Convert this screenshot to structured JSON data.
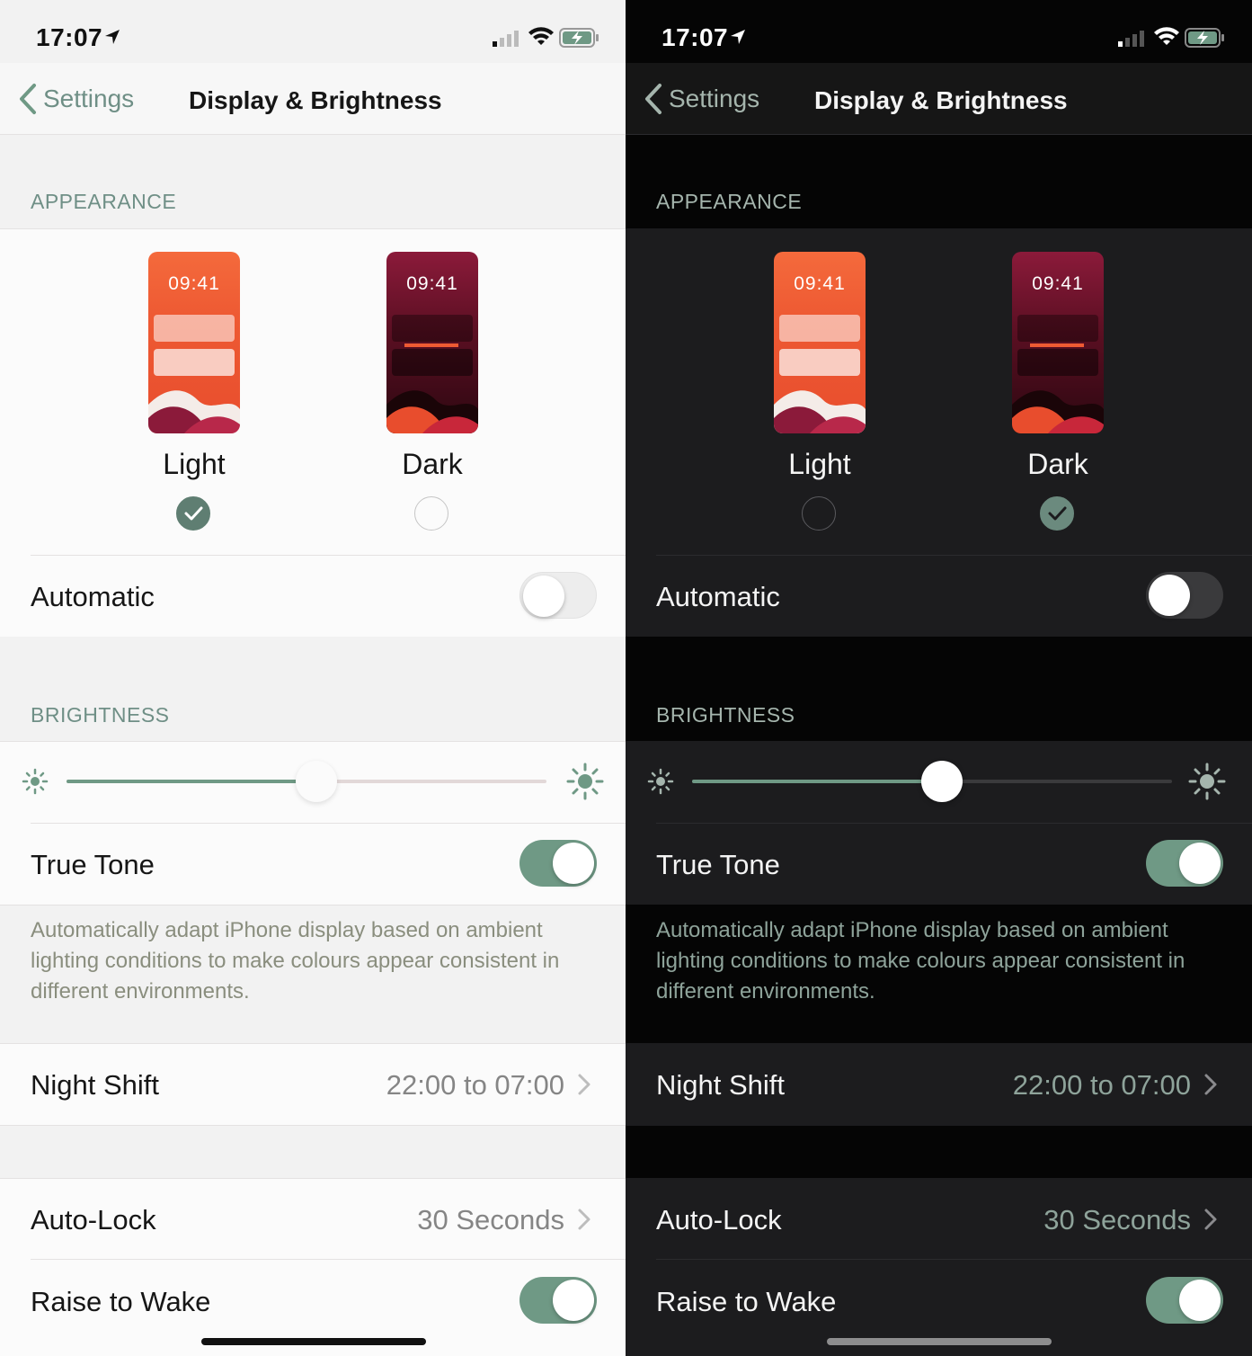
{
  "status": {
    "time": "17:07"
  },
  "nav": {
    "back_label": "Settings",
    "title": "Display & Brightness"
  },
  "appearance": {
    "header": "APPEARANCE",
    "thumb_time": "09:41",
    "light_label": "Light",
    "dark_label": "Dark",
    "automatic_label": "Automatic"
  },
  "brightness": {
    "header": "BRIGHTNESS",
    "true_tone_label": "True Tone",
    "footer": "Automatically adapt iPhone display based on ambient lighting conditions to make colours appear consistent in different environments.",
    "level_left": 0.52,
    "level_right": 0.52
  },
  "night_shift": {
    "label": "Night Shift",
    "value": "22:00 to 07:00"
  },
  "auto_lock": {
    "label": "Auto-Lock",
    "value": "30 Seconds"
  },
  "raise_to_wake": {
    "label": "Raise to Wake"
  },
  "colors": {
    "accent": "#6f9985",
    "light_bg": "#f2f2f2",
    "dark_bg": "#050505",
    "thumb_orange": "#ee5a33",
    "thumb_maroon": "#8b1a3a"
  },
  "screens": [
    {
      "theme": "light",
      "selected": "light",
      "automatic": false,
      "true_tone": true,
      "raise_to_wake": true
    },
    {
      "theme": "dark",
      "selected": "dark",
      "automatic": false,
      "true_tone": true,
      "raise_to_wake": true
    }
  ]
}
